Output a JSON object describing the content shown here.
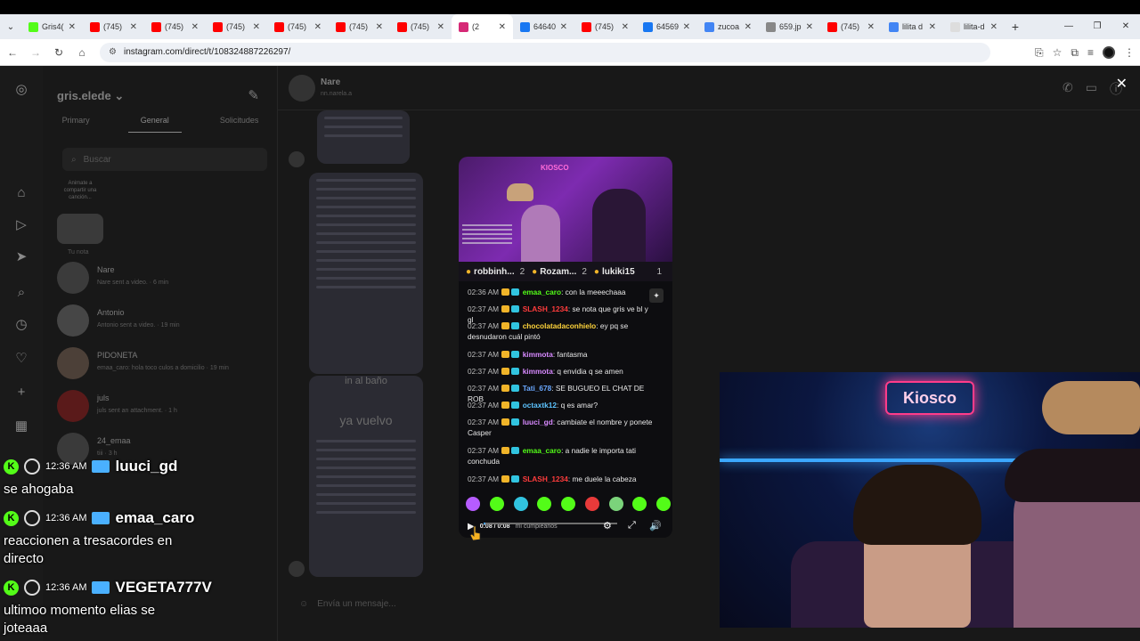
{
  "browser": {
    "tabs": [
      {
        "label": "Gris4(",
        "color": "#53fc18"
      },
      {
        "label": "(745)",
        "color": "#ff0000"
      },
      {
        "label": "(745)",
        "color": "#ff0000"
      },
      {
        "label": "(745)",
        "color": "#ff0000"
      },
      {
        "label": "(745)",
        "color": "#ff0000"
      },
      {
        "label": "(745)",
        "color": "#ff0000"
      },
      {
        "label": "(745)",
        "color": "#ff0000"
      },
      {
        "label": "(2",
        "color": "#d62976"
      },
      {
        "label": "64640",
        "color": "#1877f2"
      },
      {
        "label": "(745)",
        "color": "#ff0000"
      },
      {
        "label": "64569",
        "color": "#1877f2"
      },
      {
        "label": "zucoa",
        "color": "#4285f4"
      },
      {
        "label": "659.jp",
        "color": "#888888"
      },
      {
        "label": "(745)",
        "color": "#ff0000"
      },
      {
        "label": "lilita d",
        "color": "#4285f4"
      },
      {
        "label": "lilita-d",
        "color": "#dddddd"
      }
    ],
    "url": "instagram.com/direct/t/108324887226297/"
  },
  "inbox": {
    "account": "gris.elede",
    "tabs": [
      "Primary",
      "General",
      "Solicitudes"
    ],
    "search_placeholder": "Buscar",
    "note_text": "Animate a compartir una canción...",
    "note_label": "Tu nota",
    "conversations": [
      {
        "name": "Nare",
        "sub": "Nare sent a video. · 6 min"
      },
      {
        "name": "Antonio",
        "sub": "Antonio sent a video. · 19 min"
      },
      {
        "name": "PIDONETA",
        "sub": "emaa_caro: hola toco culos a domicilio · 19 min"
      },
      {
        "name": "juls",
        "sub": "juls sent an attachment. · 1 h"
      },
      {
        "name": "24_emaa",
        "sub": "tiii · 3 h"
      }
    ]
  },
  "chat": {
    "name": "Nare",
    "handle": "nn.narela.a",
    "composer_placeholder": "Envía un mensaje...",
    "thumb_caption": "ya vuelvo",
    "thumb_caption2": "in al baño"
  },
  "reel": {
    "sign": "KIOSCO",
    "leaderboard": [
      {
        "name": "robbinh...",
        "count": "2"
      },
      {
        "name": "Rozam...",
        "count": "2"
      },
      {
        "name": "lukiki15",
        "count": "1"
      }
    ],
    "messages": [
      {
        "time": "02:36 AM",
        "user": "emaa_caro",
        "color": "#53fc18",
        "text": ": con la meeechaaa"
      },
      {
        "time": "02:37 AM",
        "user": "SLASH_1234",
        "color": "#ff3c3c",
        "text": ": se nota que gris ve bl y gl"
      },
      {
        "time": "02:37 AM",
        "user": "chocolatadaconhielo",
        "color": "#ffd43b",
        "text": ": ey pq se desnudaron cuál pintó"
      },
      {
        "time": "02:37 AM",
        "user": "kimmota",
        "color": "#d88aff",
        "text": ": fantasma"
      },
      {
        "time": "02:37 AM",
        "user": "kimmota",
        "color": "#d88aff",
        "text": ": q envidia q se amen"
      },
      {
        "time": "02:37 AM",
        "user": "Tati_678",
        "color": "#6aa8ff",
        "text": ": SE BUGUEO EL CHAT DE ROB"
      },
      {
        "time": "02:37 AM",
        "user": "octaxtk12",
        "color": "#5dc4ff",
        "text": ": q es amar?"
      },
      {
        "time": "02:37 AM",
        "user": "luuci_gd",
        "color": "#d88aff",
        "text": ": cambiate el nombre y ponete Casper"
      },
      {
        "time": "02:37 AM",
        "user": "emaa_caro",
        "color": "#53fc18",
        "text": ": a nadie le importa tati conchuda"
      },
      {
        "time": "02:37 AM",
        "user": "SLASH_1234",
        "color": "#ff3c3c",
        "text": ": me duele la cabeza"
      }
    ],
    "time_display": "0:08 / 0:08",
    "overlay_caption": "mi cumpleaños"
  },
  "overlay": {
    "lines": [
      {
        "time": "12:36 AM",
        "user": "luuci_gd",
        "badge_color": "#4ab0ff",
        "text": "se ahogaba"
      },
      {
        "time": "12:36 AM",
        "user": "emaa_caro",
        "badge_color": "#4ab0ff",
        "text": "reaccionen a tresacordes en\ndirecto"
      },
      {
        "time": "12:36 AM",
        "user": "VEGETA777V",
        "badge_color": "#4ab0ff",
        "text": "ultimoo momento elias se\njoteaaa"
      }
    ]
  },
  "webcam": {
    "sign": "Kiosco"
  },
  "colors": {
    "accent_green": "#53fc18",
    "neon_pink": "#ff3c8a",
    "strip_blue": "#3ca8ff"
  }
}
